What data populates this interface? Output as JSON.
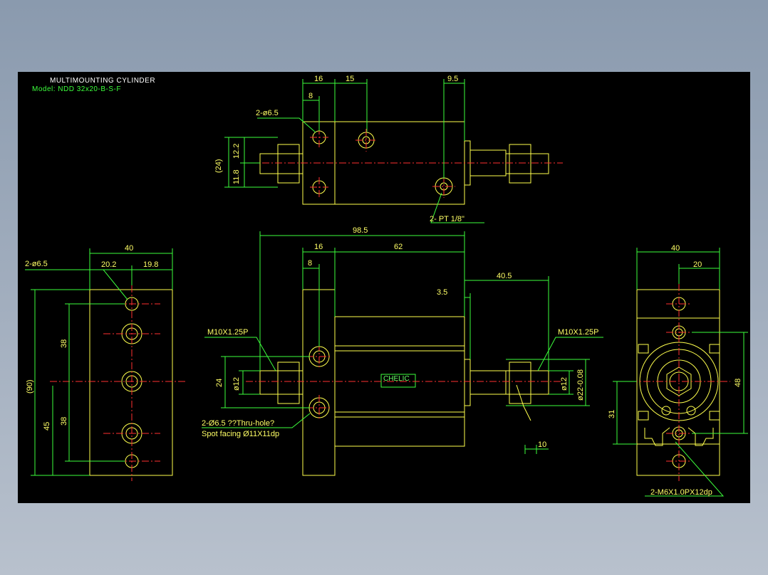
{
  "drawing": {
    "title": "MULTIMOUNTING CYLINDER",
    "model": "Model: NDD 32x20-B-S-F"
  },
  "top_view": {
    "dims": [
      "16",
      "15",
      "9.5",
      "8",
      "(24)",
      "12.2",
      "11.8"
    ],
    "label_holes": "2-ø6.5",
    "label_port": "2- PT 1/8\""
  },
  "left_view": {
    "dims": [
      "40",
      "20.2",
      "19.8",
      "(90)",
      "38",
      "45",
      "38"
    ],
    "label_holes": "2-ø6.5"
  },
  "front_view": {
    "dims": [
      "98.5",
      "16",
      "62",
      "8",
      "40.5",
      "3.5",
      "24",
      "ø12",
      "ø12",
      "ø22-0.08",
      "10"
    ],
    "thread_left": "M10X1.25P",
    "thread_right": "M10X1.25P",
    "hole_note": "2-Ø6.5 ??Thru-hole?",
    "spot_facing": "Spot facing   Ø11X11dp",
    "brand": "CHELIC"
  },
  "right_view": {
    "dims": [
      "40",
      "20",
      "48",
      "31"
    ],
    "label_tap": "2-M6X1.0PX12dp"
  },
  "colors": {
    "outline": "#ffff4d",
    "dimension": "#3cff3c",
    "centerline": "#ff3030",
    "canvas": "#000000"
  }
}
